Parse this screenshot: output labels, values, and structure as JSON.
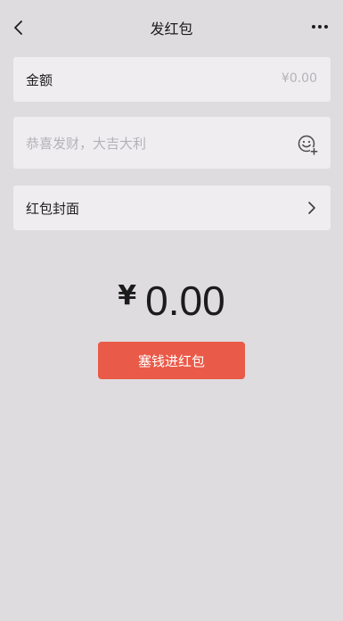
{
  "header": {
    "title": "发红包"
  },
  "amount_field": {
    "label": "金额",
    "value": "¥0.00"
  },
  "message_field": {
    "placeholder": "恭喜发财，大吉大利"
  },
  "cover_row": {
    "label": "红包封面"
  },
  "total": {
    "currency": "¥",
    "value": "0.00"
  },
  "action": {
    "label": "塞钱进红包"
  },
  "colors": {
    "background": "#dedcdf",
    "card": "#efedf0",
    "button": "#ea5a48"
  },
  "icons": {
    "back": "chevron-left-icon",
    "more": "more-dots-icon",
    "emoji": "emoji-add-icon",
    "cover_arrow": "chevron-right-icon"
  }
}
